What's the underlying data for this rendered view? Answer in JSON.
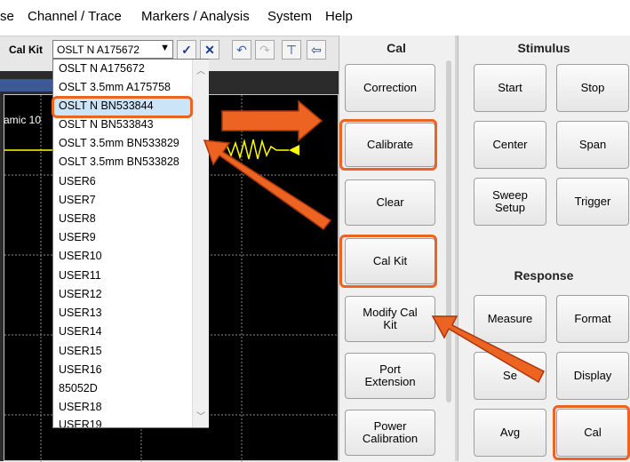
{
  "menubar": {
    "items": [
      "se",
      "Channel / Trace",
      "Markers / Analysis",
      "System",
      "Help"
    ]
  },
  "toolbar": {
    "calkit_label": "Cal Kit",
    "calkit_value": "OSLT N A175672",
    "dropdown_arrow": "▼",
    "buttons": [
      "check-icon",
      "close-icon",
      "undo-icon",
      "redo-icon",
      "window-icon",
      "back-icon"
    ]
  },
  "trace": {
    "label": "amic 10"
  },
  "dropdown": {
    "options": [
      "OSLT N A175672",
      "OSLT 3.5mm A175758",
      "OSLT N BN533844",
      "OSLT N BN533843",
      "OSLT 3.5mm BN533829",
      "OSLT 3.5mm BN533828",
      "USER6",
      "USER7",
      "USER8",
      "USER9",
      "USER10",
      "USER11",
      "USER12",
      "USER13",
      "USER14",
      "USER15",
      "USER16",
      "85052D",
      "USER18",
      "USER19"
    ],
    "selected_index": 2
  },
  "cal_panel": {
    "title": "Cal",
    "buttons": [
      "Correction",
      "Calibrate",
      "Clear",
      "Cal Kit",
      "Modify Cal Kit",
      "Port Extension",
      "Power Calibration"
    ]
  },
  "stimulus": {
    "title": "Stimulus",
    "buttons": [
      "Start",
      "Stop",
      "Center",
      "Span",
      "Sweep Setup",
      "Trigger"
    ]
  },
  "response": {
    "title": "Response",
    "buttons": [
      "Measure",
      "Format",
      "Se",
      "Display",
      "Avg",
      "Cal"
    ]
  },
  "colors": {
    "highlight": "#ed6321",
    "trace": "#ffff00"
  }
}
